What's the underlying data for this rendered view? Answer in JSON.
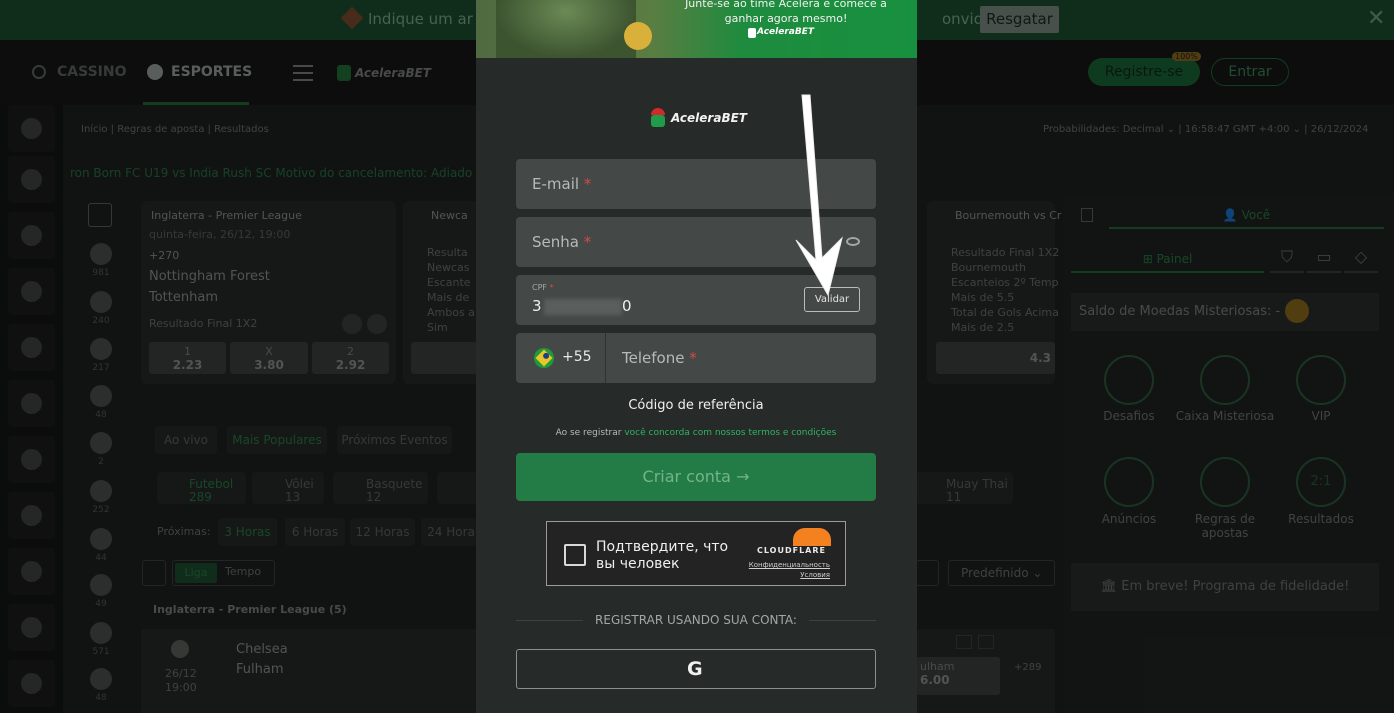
{
  "banner": {
    "text_left": "Indique um ar",
    "text_right": "onvidar",
    "button": "Resgatar",
    "close": "✕"
  },
  "header": {
    "cassino": "CASSINO",
    "esportes": "ESPORTES",
    "logo": "AceleraBET",
    "register": "Registre-se",
    "register_badge": "100%",
    "login": "Entrar"
  },
  "breadcrumb": {
    "home": "Início",
    "rules": "Regras de aposta",
    "results": "Resultados"
  },
  "topbar_right": {
    "odds": "Probabilidades: Decimal",
    "time": "16:58:47 GMT +4:00",
    "date": "26/12/2024"
  },
  "ticker": "ron Born FC U19 vs India Rush SC Motivo do cancelamento: Adiado",
  "cards": {
    "c1": {
      "league": "Inglaterra - Premier League",
      "date": "quinta-feira, 26/12, 19:00",
      "more": "+270",
      "team1": "Nottingham Forest",
      "team2": "Tottenham",
      "market": "Resultado Final 1X2",
      "o1l": "1",
      "o1v": "2.23",
      "oxl": "X",
      "oxv": "3.80",
      "o2l": "2",
      "o2v": "2.92"
    },
    "c2": {
      "league": "Newca",
      "l1": "Resulta",
      "l2": "Newcas",
      "l3": "Escante",
      "l4": "Mais de",
      "l5": "Ambos a",
      "l6": "Sim"
    },
    "c3": {
      "league": "Bournemouth vs Cr",
      "l1": "Resultado Final 1X2",
      "l2": "Bournemouth",
      "l3": "Escanteios 2º Temp",
      "l4": "Mais de 5.5",
      "l5": "Total de Gols Acima",
      "l6": "Mais de 2.5",
      "odd": "4.3"
    }
  },
  "sports_counts": [
    "981",
    "240",
    "217",
    "48",
    "2",
    "252",
    "44",
    "49",
    "571",
    "48"
  ],
  "filters": {
    "ao_vivo": "Ao vivo",
    "populares": "Mais Populares",
    "proximos": "Próximos Eventos"
  },
  "sport_tabs": {
    "futebol": "Futebol",
    "futebol_n": "289",
    "volei": "Vôlei",
    "volei_n": "13",
    "basquete": "Basquete",
    "basquete_n": "12",
    "muay": "Muay Thai",
    "muay_n": "11"
  },
  "proximas": {
    "label": "Próximas:",
    "h3": "3 Horas",
    "h6": "6 Horas",
    "h12": "12 Horas",
    "h24": "24 Hora"
  },
  "liga_tempo": {
    "liga": "Liga",
    "tempo": "Tempo",
    "predefinido": "Predefinido"
  },
  "league_header": "Inglaterra - Premier League (5)",
  "match": {
    "team1": "Chelsea",
    "team2": "Fulham",
    "date": "26/12",
    "time": "19:00",
    "odd_label": "ulham",
    "odd_value": "6.00",
    "more": "+289"
  },
  "right": {
    "tab_voce": "Você",
    "tab_painel": "Painel",
    "moedas": "Saldo de Moedas Misteriosas:",
    "moedas_val": "-",
    "desafios": "Desafios",
    "caixa": "Caixa Misteriosa",
    "vip": "VIP",
    "anuncios": "Anúncios",
    "regras": "Regras de apostas",
    "resultados": "Resultados",
    "icon_21": "2:1",
    "fidelidade": "Em breve! Programa de fidelidade!"
  },
  "modal": {
    "promo_text": "Junte-se ao time Acelera e comece a ganhar agora mesmo!",
    "promo_logo": "AceleraBET",
    "logo": "AceleraBET",
    "email_label": "E-mail",
    "senha_label": "Senha",
    "cpf_label": "CPF",
    "cpf_value_start": "3",
    "cpf_value_end": "0",
    "validar": "Validar",
    "phone_code": "+55",
    "phone_label": "Telefone",
    "required_mark": "*",
    "referral": "Código de referência",
    "terms_prefix": "Ao se registrar",
    "terms_link": "você concorda com nossos termos e condições",
    "create": "Criar conta →",
    "captcha_text_1": "Подтвердите, что",
    "captcha_text_2": "вы человек",
    "captcha_brand": "CLOUDFLARE",
    "captcha_privacy": "Конфиденциальность",
    "captcha_terms": "Условия",
    "social_label": "REGISTRAR USANDO SUA CONTA:",
    "google": "G"
  },
  "colors": {
    "accent": "#2fb45e",
    "banner": "#1d4e2f",
    "modal_bg": "#262b29",
    "field_bg": "#444947",
    "create_btn": "#237c45"
  }
}
